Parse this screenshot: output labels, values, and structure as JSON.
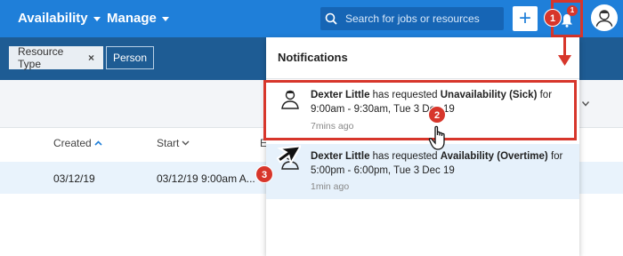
{
  "nav": {
    "items": [
      {
        "label": "Availability"
      },
      {
        "label": "Manage"
      }
    ],
    "search_placeholder": "Search for jobs or resources",
    "plus_label": "+",
    "bell_badge": "1"
  },
  "filters": {
    "chips": [
      {
        "label": "Resource Type",
        "remove": "×"
      },
      {
        "label": "Person"
      }
    ]
  },
  "table": {
    "headers": [
      "Created",
      "Start",
      "E"
    ],
    "row": [
      "03/12/19",
      "03/12/19 9:00am A..."
    ]
  },
  "notifications": {
    "title": "Notifications",
    "items": [
      {
        "name": "Dexter Little",
        "mid": " has requested ",
        "type": "Unavailability (Sick)",
        "rest": " for 9:00am - 9:30am, Tue 3 Dec 19",
        "time": "7mins ago"
      },
      {
        "name": "Dexter Little",
        "mid": " has requested ",
        "type": "Availability (Overtime)",
        "rest": " for 5:00pm - 6:00pm, Tue 3 Dec 19",
        "time": "1min ago"
      }
    ]
  },
  "callouts": [
    "1",
    "2",
    "3"
  ],
  "colors": {
    "accent": "#1f7fd9",
    "highlight": "#d7362b",
    "filterbar": "#1e5c94"
  }
}
